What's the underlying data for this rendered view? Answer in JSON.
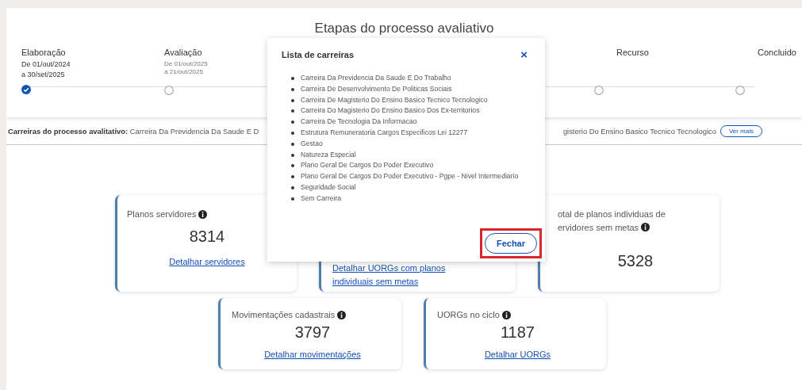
{
  "stepper": {
    "title": "Etapas do processo avaliativo",
    "steps": [
      {
        "label": "Elaboração",
        "done": true,
        "dates": [
          "De 01/out/2024",
          "a  30/set/2025"
        ]
      },
      {
        "label": "Avaliação",
        "done": false,
        "dates": [
          "De 01/out/2025",
          "a  21/out/2025"
        ]
      },
      {
        "label": "Recurso",
        "done": false
      },
      {
        "label": "Concluido",
        "done": false
      }
    ]
  },
  "careers_line": {
    "label": "Carreiras do processo avalitativo:",
    "text_left": "Carreira Da Previdencia Da Saude E D",
    "text_right": "gisterio Do Ensino Basico Tecnico Tecnologico",
    "more_button": "Ver mais"
  },
  "cards": [
    {
      "title": "Planos servidores",
      "info": true,
      "value": "8314",
      "link": "Detalhar servidores"
    },
    {
      "link": "Detalhar UORGs com planos individuais sem metas"
    },
    {
      "title": "otal de planos individuas de ervidores sem metas",
      "info": true,
      "value": "5328"
    },
    {
      "title": "Movimentações cadastrais",
      "info": true,
      "value": "3797",
      "link": "Detalhar movimentações"
    },
    {
      "title": "UORGs no ciclo",
      "info": true,
      "value": "1187",
      "link": "Detalhar UORGs"
    }
  ],
  "modal": {
    "title": "Lista de carreiras",
    "close_icon": "×",
    "items": [
      "Carreira Da Previdencia Da Saude E Do Trabalho",
      "Carreira De Desenvolvimento De Politicas Sociais",
      "Carreira De Magisterio Do Ensino Basico Tecnico Tecnologico",
      "Carreira Do Magisterio Do Ensino Basico Dos Ex-territorios",
      "Carreira De Tecnologia Da Informacao",
      "Estrutura Remuneratoria Cargos Especificos Lei 12277",
      "Gestao",
      "Natureza Especial",
      "Plano Geral De Cargos Do Poder Executivo",
      "Plano Geral De Cargos Do Poder Executivo - Pgpe - Nivel Intermediario",
      "Seguridade Social",
      "Sem Carreira"
    ],
    "close_button": {
      "label": "Fechar",
      "highlighted": true
    }
  }
}
